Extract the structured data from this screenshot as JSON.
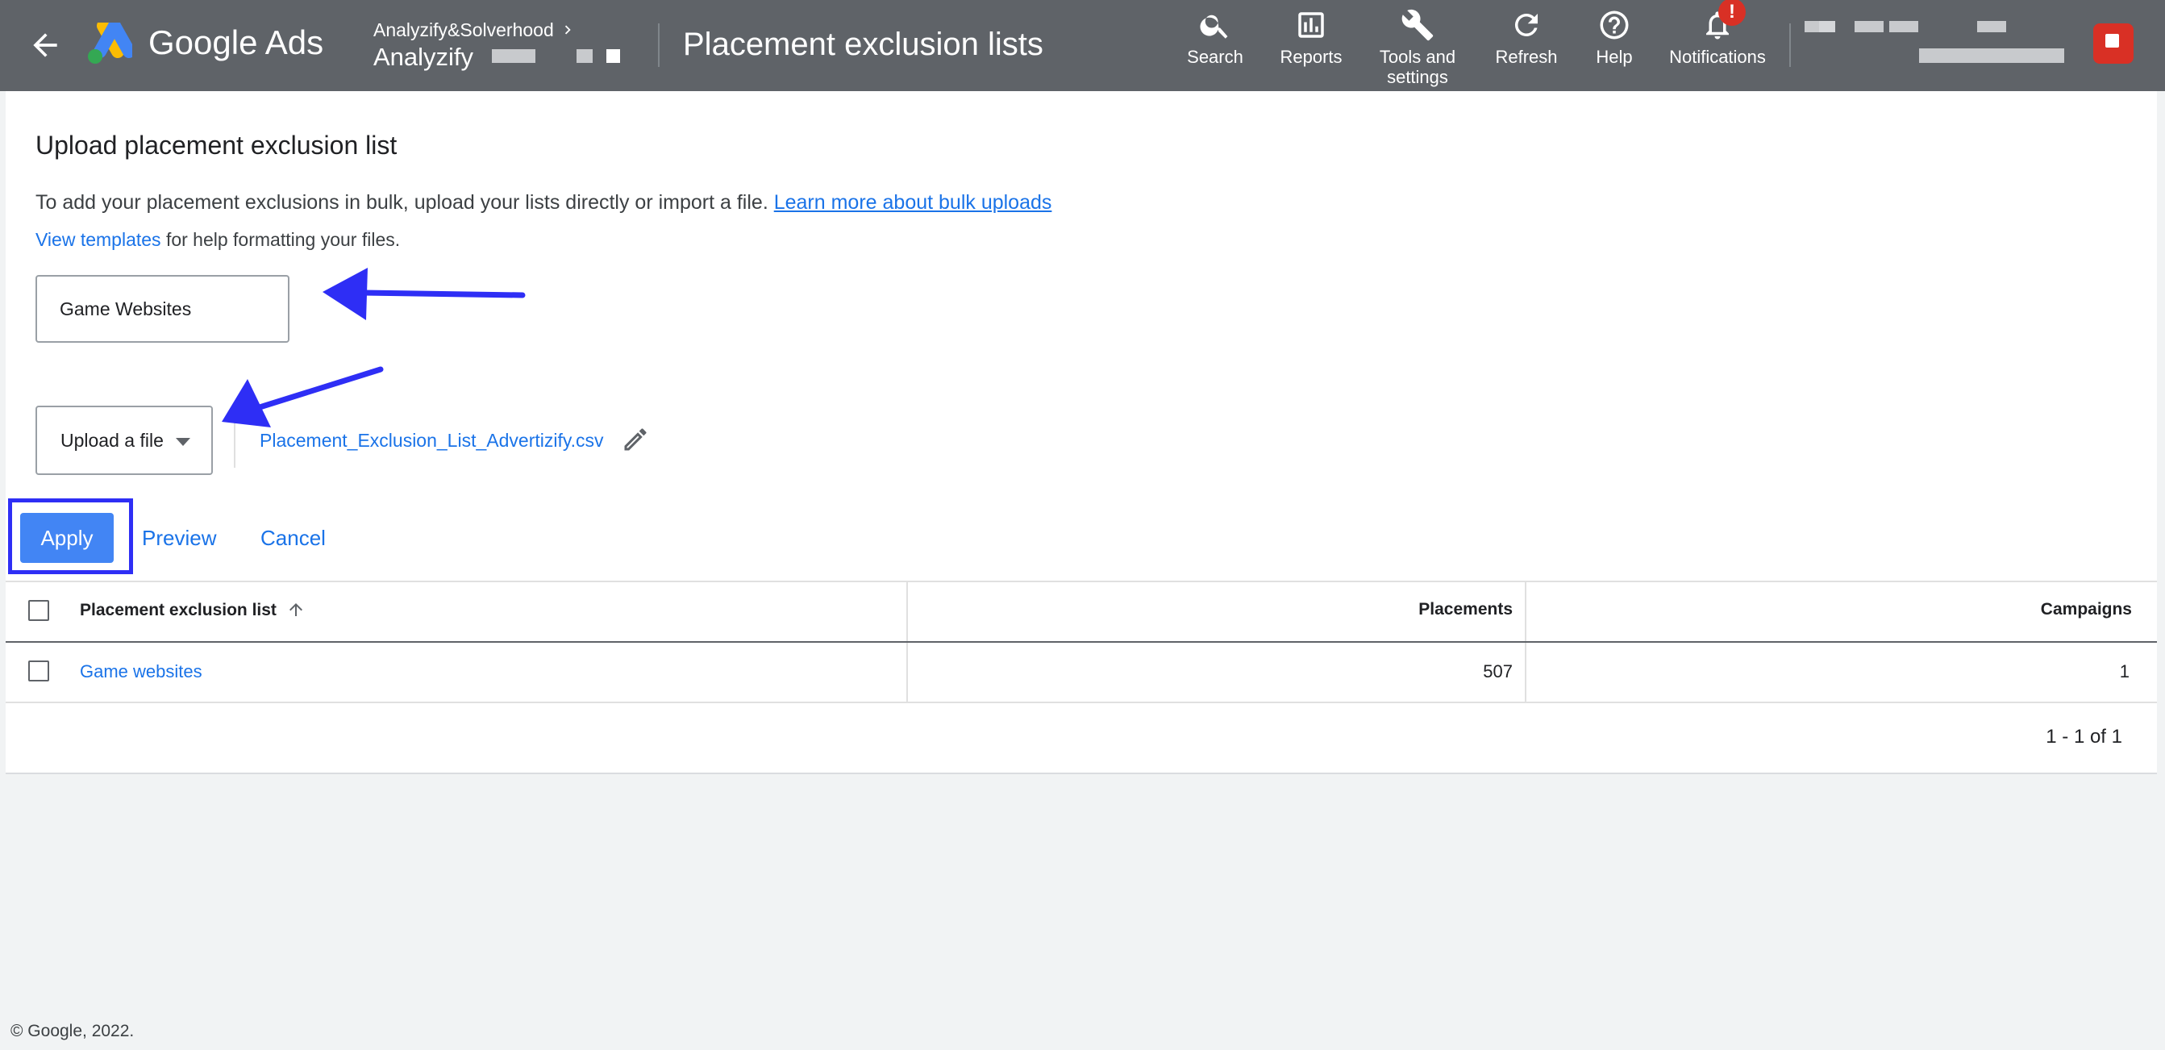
{
  "header": {
    "brand": {
      "google": "Google",
      "ads": "Ads"
    },
    "account_parent": "Analyzify&Solverhood",
    "account_name": "Analyzify",
    "page_title": "Placement exclusion lists",
    "tools": [
      {
        "label": "Search",
        "icon": "search-icon"
      },
      {
        "label": "Reports",
        "icon": "reports-icon"
      },
      {
        "label": "Tools and settings",
        "icon": "wrench-icon"
      },
      {
        "label": "Refresh",
        "icon": "refresh-icon"
      },
      {
        "label": "Help",
        "icon": "help-icon"
      },
      {
        "label": "Notifications",
        "icon": "bell-icon",
        "badge": "!"
      }
    ]
  },
  "main": {
    "heading": "Upload placement exclusion list",
    "intro": "To add your placement exclusions in bulk, upload your lists directly or import a file.",
    "intro_link": "Learn more about bulk uploads",
    "templates_link": "View templates",
    "templates_suffix": "for help formatting your files.",
    "list_name_value": "Game Websites",
    "upload_dropdown_label": "Upload a file",
    "file_name": "Placement_Exclusion_List_Advertizify.csv",
    "actions": {
      "apply": "Apply",
      "preview": "Preview",
      "cancel": "Cancel"
    }
  },
  "table": {
    "columns": [
      "Placement exclusion list",
      "Placements",
      "Campaigns"
    ],
    "rows": [
      {
        "name": "Game websites",
        "placements": "507",
        "campaigns": "1"
      }
    ],
    "pagination": "1 - 1 of 1"
  },
  "footer": {
    "copyright": "© Google, 2022."
  },
  "colors": {
    "header_bg": "#5f6368",
    "link": "#1a73e8",
    "primary_button": "#4285f4",
    "annotation": "#2e2ef5",
    "badge": "#d93025"
  }
}
